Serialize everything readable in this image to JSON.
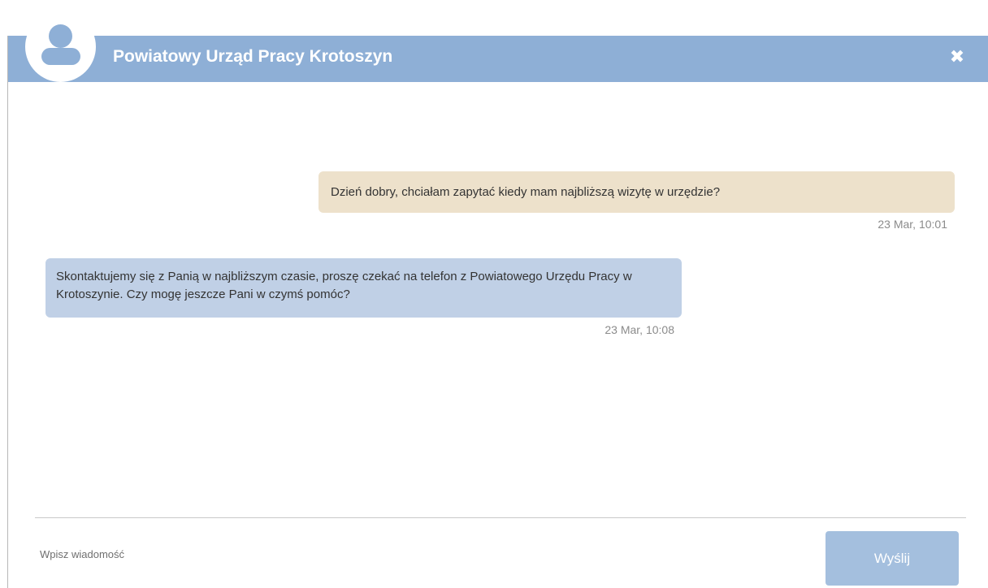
{
  "header": {
    "title": "Powiatowy Urząd Pracy Krotoszyn",
    "close_symbol": "✖",
    "background_color": "#8eafd6",
    "avatar_icon": "user-avatar-icon",
    "close_icon": "close-icon"
  },
  "messages": [
    {
      "direction": "outgoing",
      "text": "Dzień dobry, chciałam zapytać kiedy mam najbliższą wizytę w urzędzie?",
      "timestamp": "23 Mar, 10:01",
      "bubble_color": "#ede1cb"
    },
    {
      "direction": "incoming",
      "text": "Skontaktujemy się z Panią w najbliższym czasie, proszę czekać na telefon z Powiatowego Urzędu Pracy w Krotoszynie. Czy mogę jeszcze Pani w czymś pomóc?",
      "timestamp": "23 Mar, 10:08",
      "bubble_color": "#c0d0e6"
    }
  ],
  "composer": {
    "input_value": "",
    "input_placeholder": "Wpisz wiadomość",
    "send_label": "Wyślij",
    "send_button_color": "#a4bfde"
  }
}
